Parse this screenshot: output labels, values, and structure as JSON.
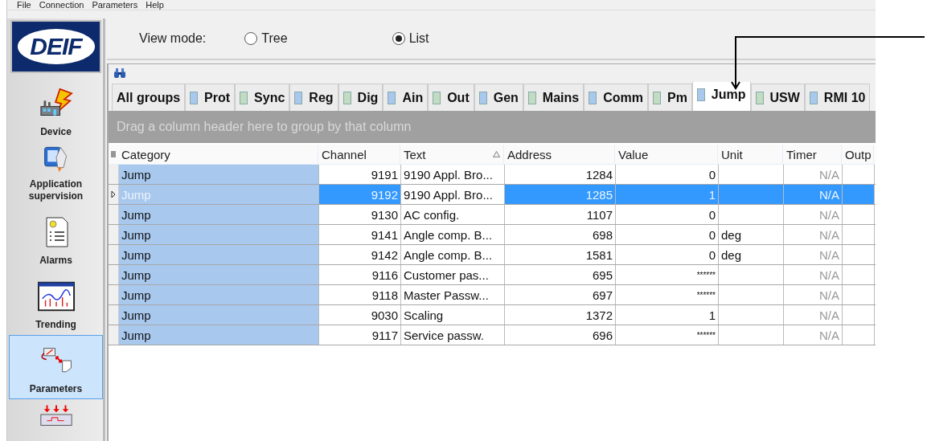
{
  "menu": [
    "File",
    "Connection",
    "Parameters",
    "Help"
  ],
  "logo": {
    "text": "DEIF"
  },
  "sidebar": {
    "items": [
      {
        "label": "Device",
        "kind": "device",
        "selected": false
      },
      {
        "label": "Application supervision",
        "kind": "app",
        "selected": false
      },
      {
        "label": "Alarms",
        "kind": "alarms",
        "selected": false
      },
      {
        "label": "Trending",
        "kind": "trending",
        "selected": false
      },
      {
        "label": "Parameters",
        "kind": "parameters",
        "selected": true
      },
      {
        "kind": "io",
        "selected": false
      }
    ]
  },
  "view_mode": {
    "label": "View mode:",
    "options": [
      {
        "label": "Tree",
        "selected": false
      },
      {
        "label": "List",
        "selected": true
      }
    ]
  },
  "group_tabs": [
    {
      "label": "All groups",
      "selected": false
    },
    {
      "label": "Prot",
      "color": "#a8c8ee",
      "selected": false
    },
    {
      "label": "Sync",
      "color": "#c2dcc2",
      "selected": false
    },
    {
      "label": "Reg",
      "color": "#a8c8ee",
      "selected": false
    },
    {
      "label": "Dig",
      "color": "#c2dcc2",
      "selected": false
    },
    {
      "label": "Ain",
      "color": "#a8c8ee",
      "selected": false
    },
    {
      "label": "Out",
      "color": "#c2dcc2",
      "selected": false
    },
    {
      "label": "Gen",
      "color": "#a8c8ee",
      "selected": false
    },
    {
      "label": "Mains",
      "color": "#c2dcc2",
      "selected": false
    },
    {
      "label": "Comm",
      "color": "#a8c8ee",
      "selected": false
    },
    {
      "label": "Pm",
      "color": "#c2dcc2",
      "selected": false
    },
    {
      "label": "Jump",
      "color": "#a8c8ee",
      "selected": true
    },
    {
      "label": "USW",
      "color": "#c2dcc2",
      "selected": false
    },
    {
      "label": "RMI 10",
      "color": "#a8c8ee",
      "selected": false
    }
  ],
  "group_by_hint": "Drag a column header here to group by that column",
  "table": {
    "columns": [
      {
        "label": "Category"
      },
      {
        "label": "Channel"
      },
      {
        "label": "Text",
        "sorted": true
      },
      {
        "label": "Address"
      },
      {
        "label": "Value"
      },
      {
        "label": "Unit"
      },
      {
        "label": "Timer"
      },
      {
        "label": "Outp"
      }
    ],
    "rows": [
      {
        "selected": false,
        "cells": [
          "Jump",
          "9191",
          "9190 Appl. Bro...",
          "1284",
          "0",
          "",
          "N/A",
          ""
        ]
      },
      {
        "selected": true,
        "cells": [
          "Jump",
          "9192",
          "9190 Appl. Bro...",
          "1285",
          "1",
          "",
          "N/A",
          ""
        ]
      },
      {
        "selected": false,
        "cells": [
          "Jump",
          "9130",
          "AC config.",
          "1107",
          "0",
          "",
          "N/A",
          ""
        ]
      },
      {
        "selected": false,
        "cells": [
          "Jump",
          "9141",
          "Angle comp. B...",
          "698",
          "0",
          "deg",
          "N/A",
          ""
        ]
      },
      {
        "selected": false,
        "cells": [
          "Jump",
          "9142",
          "Angle comp. B...",
          "1581",
          "0",
          "deg",
          "N/A",
          ""
        ]
      },
      {
        "selected": false,
        "cells": [
          "Jump",
          "9116",
          "Customer pas...",
          "695",
          "******",
          "",
          "N/A",
          ""
        ]
      },
      {
        "selected": false,
        "cells": [
          "Jump",
          "9118",
          "Master  Passw...",
          "697",
          "******",
          "",
          "N/A",
          ""
        ]
      },
      {
        "selected": false,
        "cells": [
          "Jump",
          "9030",
          "Scaling",
          "1372",
          "1",
          "",
          "N/A",
          ""
        ]
      },
      {
        "selected": false,
        "cells": [
          "Jump",
          "9117",
          "Service passw.",
          "696",
          "******",
          "",
          "N/A",
          ""
        ]
      }
    ]
  }
}
